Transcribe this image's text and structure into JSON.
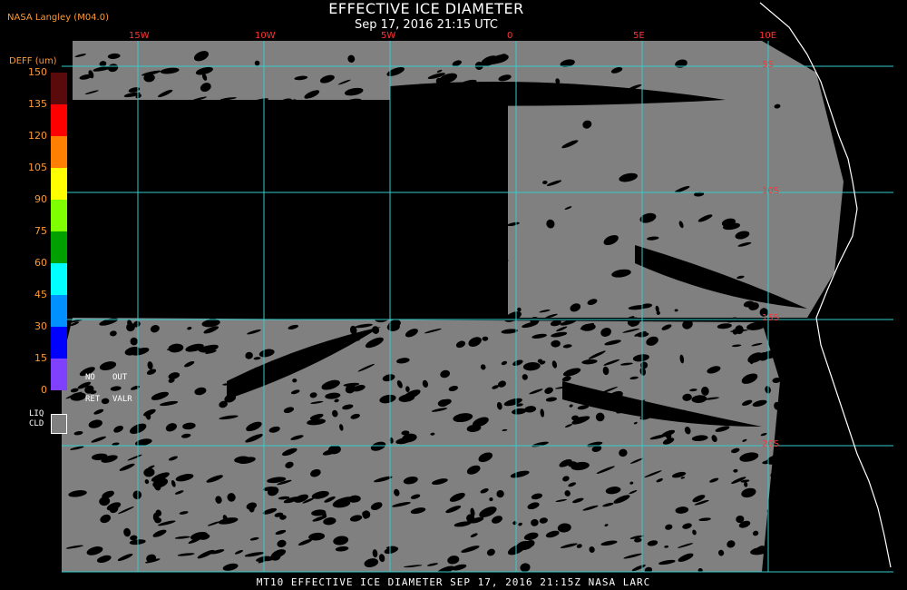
{
  "header": {
    "title": "EFFECTIVE ICE DIAMETER",
    "subtitle": "Sep 17, 2016 21:15 UTC",
    "producer": "NASA Langley (M04.0)"
  },
  "legend": {
    "title": "DEFF (um)",
    "ticks": [
      "150",
      "135",
      "120",
      "105",
      "90",
      "75",
      "60",
      "45",
      "30",
      "15",
      "0"
    ],
    "colors": [
      "#5a0a0a",
      "#ff0000",
      "#ff8000",
      "#ffff00",
      "#80ff00",
      "#00a000",
      "#00ffff",
      "#0090ff",
      "#0000ff",
      "#8040ff"
    ],
    "no_ret": "NO\nRET",
    "out_valr": "OUT\nVALR",
    "liq_cld": "LIQ\nCLD",
    "liq_color": "#808080"
  },
  "map": {
    "lon_labels": [
      "15W",
      "10W",
      "5W",
      "0",
      "5E",
      "10E"
    ],
    "lat_labels": [
      "5S",
      "10S",
      "15S",
      "20S"
    ],
    "grid_color": "#33cccc",
    "cloud_color": "#808080",
    "coast_color": "#ffffff"
  },
  "footer": "MT10  EFFECTIVE ICE DIAMETER  SEP 17, 2016 21:15Z  NASA LARC"
}
